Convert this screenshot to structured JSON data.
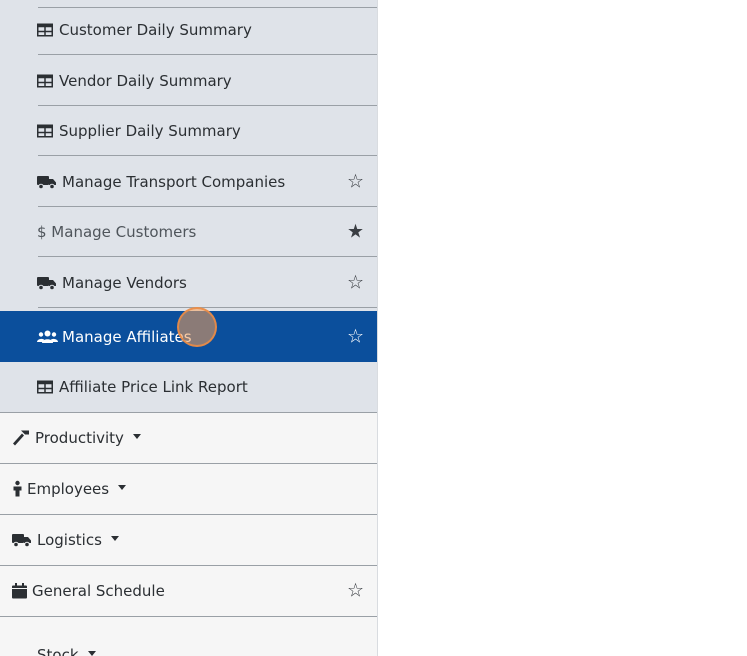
{
  "submenu": {
    "items": [
      {
        "label": "Customer Daily Summary",
        "icon": "table-icon",
        "star": "",
        "state": "normal"
      },
      {
        "label": "Vendor Daily Summary",
        "icon": "table-icon",
        "star": "",
        "state": "normal"
      },
      {
        "label": "Supplier Daily Summary",
        "icon": "table-icon",
        "star": "",
        "state": "normal"
      },
      {
        "label": "Manage Transport Companies",
        "icon": "truck-icon",
        "star": "☆",
        "state": "normal"
      },
      {
        "label": "$ Manage Customers",
        "icon": "dollar-icon",
        "star": "★",
        "state": "muted"
      },
      {
        "label": "Manage Vendors",
        "icon": "truck-icon",
        "star": "☆",
        "state": "normal"
      },
      {
        "label": "Manage Affiliates",
        "icon": "users-icon",
        "star": "☆",
        "state": "active"
      },
      {
        "label": "Affiliate Price Link Report",
        "icon": "table-icon",
        "star": "",
        "state": "normal"
      }
    ]
  },
  "menu": {
    "items": [
      {
        "label": "Productivity",
        "icon": "hammer-icon",
        "dropdown": true
      },
      {
        "label": "Employees",
        "icon": "person-icon",
        "dropdown": true
      },
      {
        "label": "Logistics",
        "icon": "truck-icon",
        "dropdown": true
      },
      {
        "label": "General Schedule",
        "icon": "calendar-icon",
        "star": "☆"
      },
      {
        "label": "Stock",
        "icon": "box-icon",
        "dropdown": true
      }
    ]
  },
  "colors": {
    "active_bg": "#0b4f9c",
    "submenu_bg": "#dfe3e9",
    "menu_bg": "#f6f6f6",
    "cursor": "#f5a05a"
  }
}
